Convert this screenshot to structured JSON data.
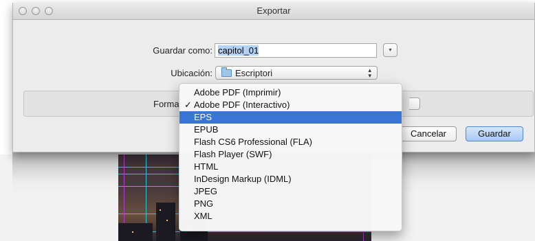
{
  "window": {
    "title": "Exportar"
  },
  "form": {
    "save_as_label": "Guardar como:",
    "file_name": "capitol_01",
    "location_label": "Ubicación:",
    "location_value": "Escriptori",
    "format_label": "Formato"
  },
  "buttons": {
    "cancel": "Cancelar",
    "save": "Guardar"
  },
  "format_menu": {
    "items": [
      {
        "label": "Adobe PDF (Imprimir)"
      },
      {
        "label": "Adobe PDF (Interactivo)",
        "checked": true
      },
      {
        "label": "EPS",
        "highlighted": true
      },
      {
        "label": "EPUB"
      },
      {
        "label": "Flash CS6 Professional (FLA)"
      },
      {
        "label": "Flash Player (SWF)"
      },
      {
        "label": "HTML"
      },
      {
        "label": "InDesign Markup (IDML)"
      },
      {
        "label": "JPEG"
      },
      {
        "label": "PNG"
      },
      {
        "label": "XML"
      }
    ]
  },
  "icons": {
    "traffic_lights": [
      "close-icon",
      "minimize-icon",
      "zoom-icon"
    ],
    "location": "folder-icon",
    "checkmark": "✓",
    "expand": "▾",
    "updown": "⬍"
  },
  "colors": {
    "menu_highlight": "#3875d7",
    "default_button": "#a8c9f0",
    "text_selection": "#b3d2f5"
  }
}
